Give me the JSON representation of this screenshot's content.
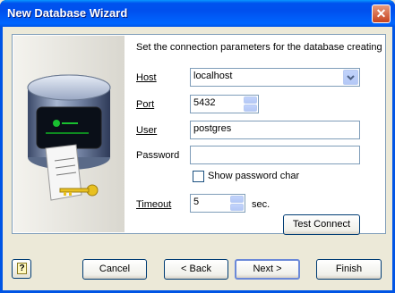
{
  "window": {
    "title": "New Database Wizard"
  },
  "heading": "Set the connection parameters for the database creating",
  "form": {
    "host_label": "Host",
    "host_value": "localhost",
    "port_label": "Port",
    "port_value": "5432",
    "user_label": "User",
    "user_value": "postgres",
    "password_label": "Password",
    "password_value": "",
    "show_password_label": "Show password char",
    "timeout_label": "Timeout",
    "timeout_value": "5",
    "timeout_unit": "sec.",
    "test_connect_label": "Test Connect"
  },
  "footer": {
    "cancel_label": "Cancel",
    "back_label": "< Back",
    "next_label": "Next >",
    "finish_label": "Finish"
  },
  "icons": {
    "help": "help-icon",
    "close": "close-icon",
    "illustration": "database-server-illustration"
  },
  "colors": {
    "titlebar": "#0053EE",
    "dialog_bg": "#ECE9D8",
    "input_border": "#7F9DB9"
  }
}
